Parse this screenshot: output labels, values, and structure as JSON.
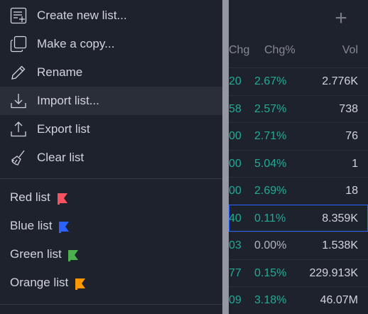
{
  "menu": {
    "items": [
      {
        "label": "Create new list...",
        "icon": "create-list-icon"
      },
      {
        "label": "Make a copy...",
        "icon": "copy-icon"
      },
      {
        "label": "Rename",
        "icon": "pencil-icon"
      },
      {
        "label": "Import list...",
        "icon": "import-icon",
        "highlighted": true
      },
      {
        "label": "Export list",
        "icon": "export-icon"
      },
      {
        "label": "Clear list",
        "icon": "broom-icon"
      }
    ],
    "flag_lists": [
      {
        "label": "Red list",
        "color": "#f7525f"
      },
      {
        "label": "Blue list",
        "color": "#2962ff"
      },
      {
        "label": "Green list",
        "color": "#4caf50"
      },
      {
        "label": "Orange list",
        "color": "#ff9800"
      }
    ]
  },
  "watchlist": {
    "headers": {
      "chg_partial": "Chg",
      "chg_pct": "Chg%",
      "vol": "Vol"
    },
    "rows": [
      {
        "chg": "20",
        "chg_pct": "2.67%",
        "vol": "2.776K"
      },
      {
        "chg": "58",
        "chg_pct": "2.57%",
        "vol": "738"
      },
      {
        "chg": "00",
        "chg_pct": "2.71%",
        "vol": "76"
      },
      {
        "chg": "00",
        "chg_pct": "5.04%",
        "vol": "1"
      },
      {
        "chg": "00",
        "chg_pct": "2.69%",
        "vol": "18"
      },
      {
        "chg": "40",
        "chg_pct": "0.11%",
        "vol": "8.359K",
        "selected": true
      },
      {
        "chg": "03",
        "chg_pct": "0.00%",
        "vol": "1.538K",
        "flat": true
      },
      {
        "chg": "77",
        "chg_pct": "0.15%",
        "vol": "229.913K"
      },
      {
        "chg": "09",
        "chg_pct": "3.18%",
        "vol": "46.07M"
      }
    ]
  },
  "colors": {
    "up": "#22ab94",
    "selection": "#2962ff",
    "panel": "#1e222d"
  }
}
